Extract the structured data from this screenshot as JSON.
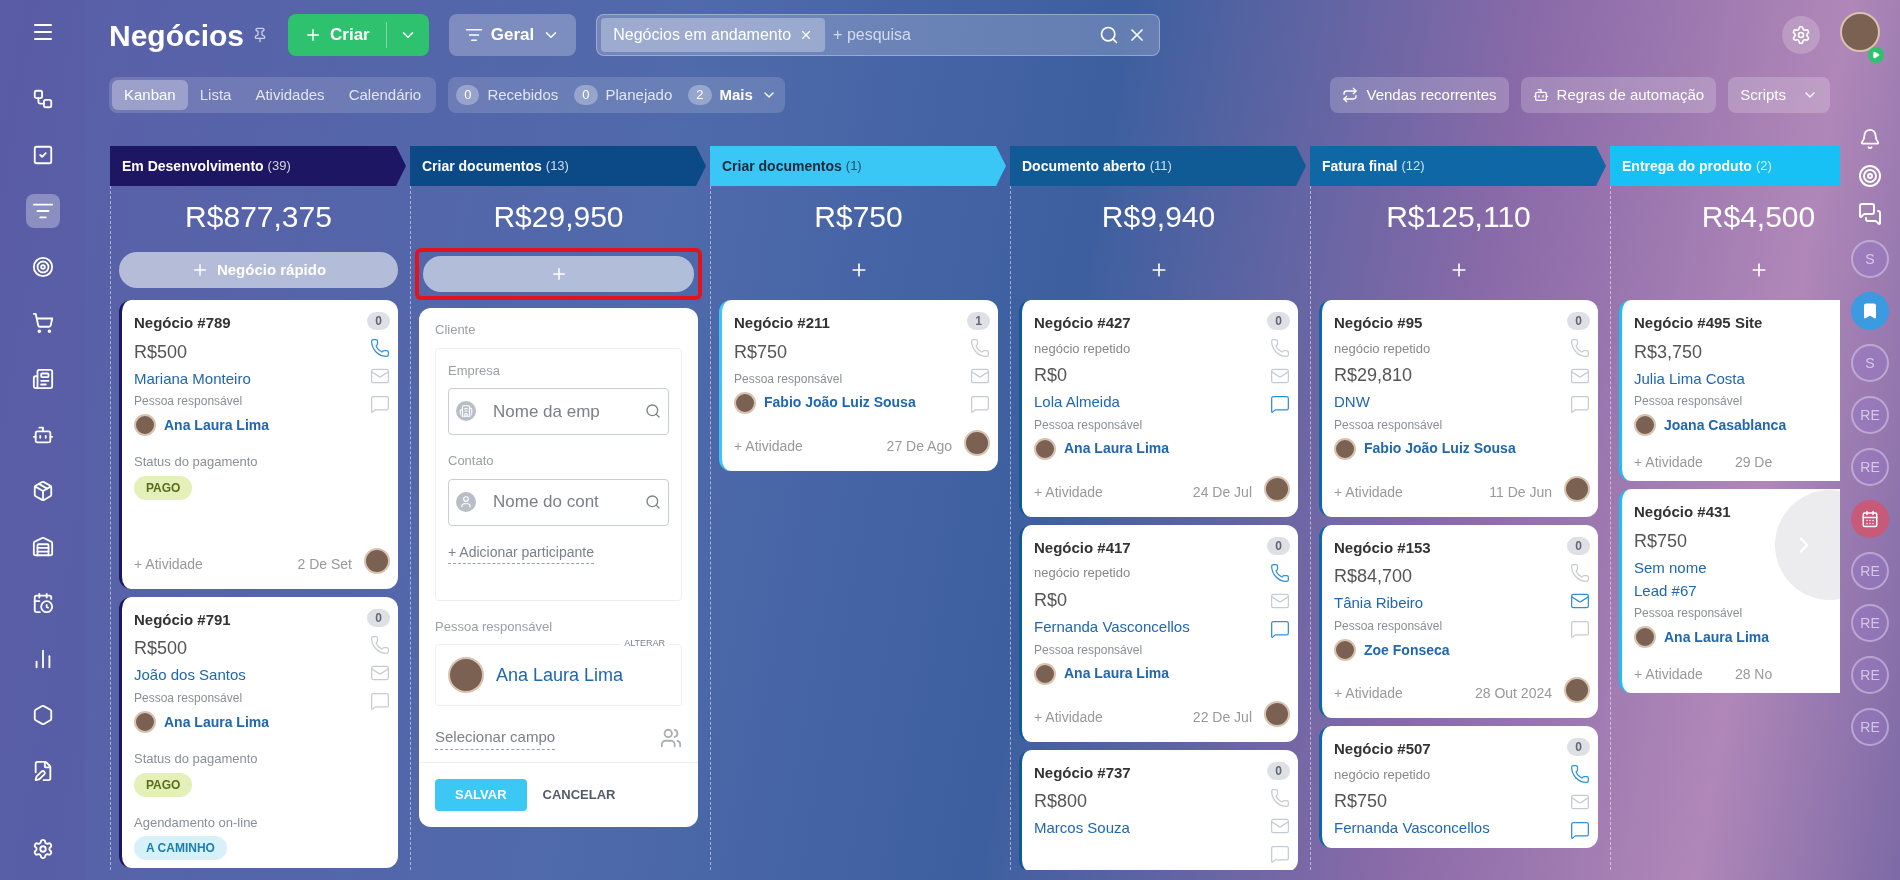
{
  "sidebar": [
    {
      "selected": false
    },
    {
      "selected": false
    },
    {
      "selected": true
    },
    {
      "selected": false
    },
    {
      "selected": false
    },
    {
      "selected": false
    },
    {
      "selected": false
    },
    {
      "selected": false
    },
    {
      "selected": false
    },
    {
      "selected": false
    },
    {
      "selected": false
    },
    {
      "selected": false
    },
    {
      "selected": false
    }
  ],
  "header": {
    "title": "Negócios",
    "create_label": "Criar",
    "filter_label": "Geral",
    "search_chip": "Negócios em andamento",
    "search_placeholder": "+ pesquisa"
  },
  "view_tabs": [
    {
      "label": "Kanban",
      "selected": true
    },
    {
      "label": "Lista",
      "selected": false
    },
    {
      "label": "Atividades",
      "selected": false
    },
    {
      "label": "Calendário",
      "selected": false
    }
  ],
  "counters": [
    {
      "count": "0",
      "label": "Recebidos",
      "caret": false
    },
    {
      "count": "0",
      "label": "Planejado",
      "caret": false
    },
    {
      "count": "2",
      "label": "Mais",
      "caret": true
    }
  ],
  "toolbar_buttons": [
    {
      "label": "Vendas recorrentes",
      "kind": "recurring"
    },
    {
      "label": "Regras de automação",
      "kind": "robot"
    },
    {
      "label": "Scripts",
      "kind": "dropdown"
    }
  ],
  "columns": [
    {
      "title": "Em Desenvolvimento",
      "count": "(39)",
      "color": "#1d1763",
      "light": false,
      "total": "R$877,375",
      "quick_add": {
        "kind": "pill",
        "label": "Negócio rápido",
        "highlighted": false
      },
      "cards": [
        {
          "title": "Negócio #789",
          "counter": "0",
          "amount": "R$500",
          "contacts": [
            "Mariana Monteiro"
          ],
          "responsible_label": "Pessoa responsável",
          "responsible": "Ana Laura Lima",
          "fields": [
            {
              "label": "Status do pagamento",
              "tag": "PAGO",
              "kind": "paid"
            }
          ],
          "activity": "+ Atividade",
          "date": "2 De Set",
          "icons": {
            "phone": true,
            "mail": false,
            "chat": false
          }
        },
        {
          "title": "Negócio #791",
          "counter": "0",
          "amount": "R$500",
          "contacts": [
            "João dos Santos"
          ],
          "responsible_label": "Pessoa responsável",
          "responsible": "Ana Laura Lima",
          "fields": [
            {
              "label": "Status do pagamento",
              "tag": "PAGO",
              "kind": "paid"
            },
            {
              "label": "Agendamento on-line",
              "tag": "A CAMINHO",
              "kind": "transit"
            }
          ],
          "icons": {
            "phone": false,
            "mail": false,
            "chat": false
          }
        }
      ]
    },
    {
      "title": "Criar documentos",
      "count": "(13)",
      "color": "#0b4a86",
      "light": false,
      "total": "R$29,950",
      "quick_add": {
        "kind": "pill",
        "highlighted": true
      },
      "form": {
        "client_label": "Cliente",
        "company_label": "Empresa",
        "company_placeholder": "Nome da emp",
        "contact_label": "Contato",
        "contact_placeholder": "Nome do cont",
        "add_participant": "+ Adicionar participante",
        "responsible_label": "Pessoa responsável",
        "change": "ALTERAR",
        "responsible": "Ana Laura Lima",
        "select_field": "Selecionar campo",
        "save": "SALVAR",
        "cancel": "CANCELAR"
      }
    },
    {
      "title": "Criar documentos",
      "count": "(1)",
      "color": "#3ac7f6",
      "light": true,
      "total": "R$750",
      "quick_add": {
        "kind": "plain",
        "highlighted": false
      },
      "cards": [
        {
          "title": "Negócio #211",
          "counter": "1",
          "amount": "R$750",
          "responsible_label": "Pessoa responsável",
          "responsible": "Fabio João Luiz Sousa",
          "activity": "+ Atividade",
          "date": "27 De Ago",
          "icons": {
            "phone": false,
            "mail": false,
            "chat": false
          }
        }
      ]
    },
    {
      "title": "Documento aberto",
      "count": "(11)",
      "color": "#105a96",
      "light": false,
      "total": "R$9,940",
      "quick_add": {
        "kind": "plain",
        "highlighted": false
      },
      "cards": [
        {
          "title": "Negócio #427",
          "counter": "0",
          "subtitle": "negócio repetido",
          "amount": "R$0",
          "contacts": [
            "Lola Almeida"
          ],
          "responsible_label": "Pessoa responsável",
          "responsible": "Ana Laura Lima",
          "activity": "+ Atividade",
          "date": "24 De Jul",
          "icons": {
            "phone": false,
            "mail": false,
            "chat": true
          }
        },
        {
          "title": "Negócio #417",
          "counter": "0",
          "subtitle": "negócio repetido",
          "amount": "R$0",
          "contacts": [
            "Fernanda Vasconcellos"
          ],
          "responsible_label": "Pessoa responsável",
          "responsible": "Ana Laura Lima",
          "activity": "+ Atividade",
          "date": "22 De Jul",
          "icons": {
            "phone": true,
            "mail": false,
            "chat": true
          }
        },
        {
          "title": "Negócio #737",
          "counter": "0",
          "amount": "R$800",
          "contacts": [
            "Marcos Souza"
          ],
          "icons": {
            "phone": false,
            "mail": false,
            "chat": false
          }
        }
      ]
    },
    {
      "title": "Fatura final",
      "count": "(12)",
      "color": "#0f67a6",
      "light": false,
      "total": "R$125,110",
      "quick_add": {
        "kind": "plain",
        "highlighted": false
      },
      "cards": [
        {
          "title": "Negócio #95",
          "counter": "0",
          "subtitle": "negócio repetido",
          "amount": "R$29,810",
          "contacts": [
            "DNW"
          ],
          "responsible_label": "Pessoa responsável",
          "responsible": "Fabio João Luiz Sousa",
          "activity": "+ Atividade",
          "date": "11 De Jun",
          "icons": {
            "phone": false,
            "mail": false,
            "chat": false
          }
        },
        {
          "title": "Negócio #153",
          "counter": "0",
          "amount": "R$84,700",
          "contacts": [
            "Tânia Ribeiro"
          ],
          "responsible_label": "Pessoa responsável",
          "responsible": "Zoe Fonseca",
          "activity": "+ Atividade",
          "date": "28 Out 2024",
          "icons": {
            "phone": false,
            "mail": true,
            "chat": false
          }
        },
        {
          "title": "Negócio #507",
          "counter": "0",
          "subtitle": "negócio repetido",
          "amount": "R$750",
          "contacts": [
            "Fernanda Vasconcellos"
          ],
          "icons": {
            "phone": true,
            "mail": false,
            "chat": true
          }
        }
      ]
    },
    {
      "title": "Entrega do produto",
      "count": "(2)",
      "color": "#17c0f5",
      "light": false,
      "total": "R$4,500",
      "quick_add": {
        "kind": "plain",
        "highlighted": false
      },
      "cards": [
        {
          "title": "Negócio #495 Site",
          "amount": "R$3,750",
          "contacts": [
            "Julia Lima Costa"
          ],
          "responsible_label": "Pessoa responsável",
          "responsible": "Joana Casablanca",
          "activity": "+ Atividade",
          "date": "29 De"
        },
        {
          "title": "Negócio #431",
          "amount": "R$750",
          "contacts": [
            "Sem nome",
            "Lead #67"
          ],
          "responsible_label": "Pessoa responsável",
          "responsible": "Ana Laura Lima",
          "activity": "+ Atividade",
          "date": "28 No"
        }
      ]
    }
  ],
  "right_rail": [
    {
      "kind": "bell"
    },
    {
      "kind": "target"
    },
    {
      "kind": "chat"
    },
    {
      "kind": "letter",
      "text": "S"
    },
    {
      "kind": "bookmark"
    },
    {
      "kind": "letter",
      "text": "S"
    },
    {
      "kind": "letter",
      "text": "RE"
    },
    {
      "kind": "letter",
      "text": "RE"
    },
    {
      "kind": "calendar"
    },
    {
      "kind": "letter",
      "text": "RE"
    },
    {
      "kind": "letter",
      "text": "RE"
    },
    {
      "kind": "letter",
      "text": "RE"
    },
    {
      "kind": "letter",
      "text": "RE"
    }
  ]
}
